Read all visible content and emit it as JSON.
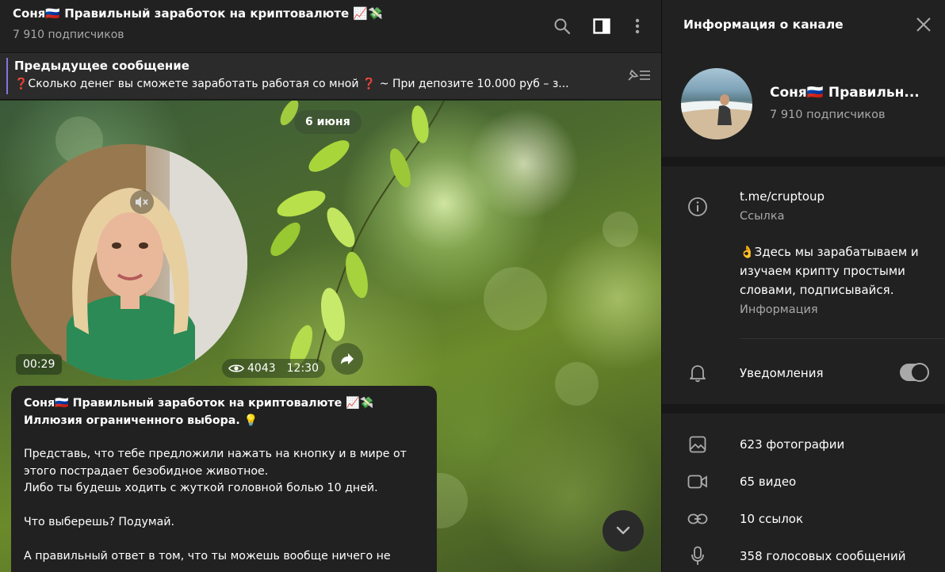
{
  "chat": {
    "title": "Соня🇷🇺 Правильный заработок на криптовалюте 📈💸",
    "subscribers": "7 910 подписчиков",
    "pinned": {
      "label": "Предыдущее сообщение",
      "text": "❓Сколько денег вы сможете заработать работая со мной ❓  ~ При депозите 10.000 руб – з..."
    },
    "date_pill": "6 июня",
    "video": {
      "duration": "00:29",
      "views": "4043",
      "time": "12:30"
    },
    "message": {
      "sender": "Соня🇷🇺 Правильный заработок на криптовалюте 📈💸",
      "heading": "Иллюзия ограниченного выбора. 💡",
      "body": "Представь, что тебе предложили нажать на кнопку и в мире от этого пострадает безобидное животное.\nЛибо ты будешь ходить с жуткой головной болью 10 дней.\n\nЧто выберешь? Подумай.\n\nА правильный ответ в том, что ты можешь вообще ничего не"
    }
  },
  "panel": {
    "title": "Информация о канале",
    "channel_name": "Соня🇷🇺 Правильн...",
    "subscribers": "7 910 подписчиков",
    "link": "t.me/cruptoup",
    "link_label": "Ссылка",
    "description": "👌Здесь мы зарабатываем и изучаем крипту простыми словами, подписывайся.",
    "description_label": "Информация",
    "notifications_label": "Уведомления",
    "notifications_on": true,
    "media": [
      {
        "icon": "photo-icon",
        "label": "623 фотографии"
      },
      {
        "icon": "video-icon",
        "label": "65 видео"
      },
      {
        "icon": "link-icon",
        "label": "10 ссылок"
      },
      {
        "icon": "mic-icon",
        "label": "358 голосовых сообщений"
      }
    ]
  },
  "colors": {
    "pinned_accent": "#8774e1",
    "panel_bg": "#212121",
    "secondary_text": "#a8a8a8"
  }
}
